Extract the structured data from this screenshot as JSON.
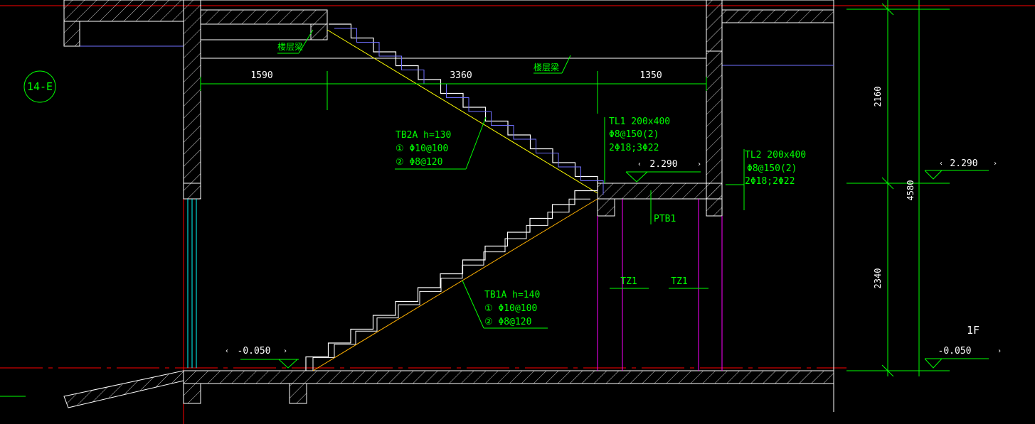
{
  "axis_tag": "14-E",
  "beam_labels": {
    "upper_left": "楼层梁",
    "upper_mid": "楼层梁"
  },
  "dimensions": {
    "top_left": "1590",
    "top_mid": "3360",
    "top_right": "1350",
    "right_upper": "2160",
    "right_total": "4580",
    "right_lower": "2340"
  },
  "TB2A": {
    "title": "TB2A  h=130",
    "rebar1": "① Φ10@100",
    "rebar2": "②  Φ8@120"
  },
  "TB1A": {
    "title": "TB1A  h=140",
    "rebar1": "① Φ10@100",
    "rebar2": "②  Φ8@120"
  },
  "TL1": {
    "title": "TL1  200x400",
    "stirrup": "Φ8@150(2)",
    "main": "2Φ18;3Φ22"
  },
  "TL2": {
    "title": "TL2  200x400",
    "stirrup": "Φ8@150(2)",
    "main": "2Φ18;2Φ22"
  },
  "platform_slab": "PTB1",
  "columns": {
    "left": "TZ1",
    "right": "TZ1"
  },
  "elevations": {
    "landing": "2.290",
    "landing_right": "2.290",
    "ground_left": "-0.050",
    "ground_right": "-0.050",
    "floor_tag": "1F"
  },
  "colors": {
    "line_white": "#ffffff",
    "line_green": "#00ff00",
    "line_yellow": "#ffff00",
    "line_red": "#ff0000",
    "line_magenta": "#ff00ff",
    "line_cyan": "#00ffff",
    "line_orange": "#ffb000",
    "line_blue": "#7070ff"
  }
}
